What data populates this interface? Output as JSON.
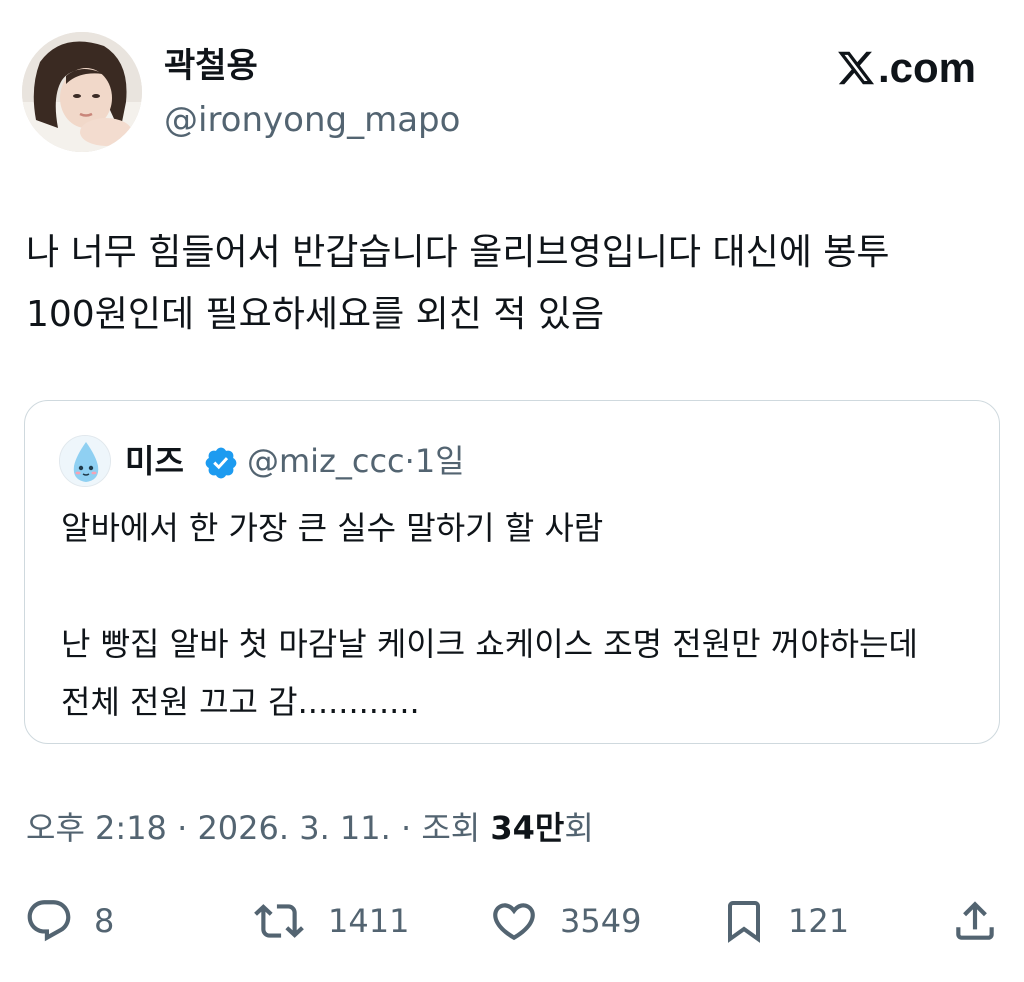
{
  "author": {
    "display_name": "곽철용",
    "handle": "@ironyong_mapo"
  },
  "brand": {
    "logo_text": ".com"
  },
  "tweet": {
    "text": "나 너무 힘들어서 반갑습니다 올리브영입니다 대신에 봉투 100원인데 필요하세요를 외친 적 있음"
  },
  "quoted_tweet": {
    "display_name": "미즈",
    "verified": true,
    "handle": "@miz_ccc",
    "separator": "·",
    "age": "1일",
    "text": "알바에서 한 가장 큰 실수 말하기 할 사람\n\n난 빵집 알바 첫 마감날 케이크 쇼케이스 조명 전원만 꺼야하는데 전체 전원 끄고 감............"
  },
  "timestamp": {
    "time": "오후 2:18",
    "dot1": " · ",
    "date": "2026. 3. 11.",
    "dot2": " · ",
    "views_label": "조회 ",
    "views_value": "34만",
    "views_suffix": "회"
  },
  "actions": {
    "reply_count": "8",
    "retweet_count": "1411",
    "like_count": "3549",
    "bookmark_count": "121"
  },
  "colors": {
    "text_primary": "#0f1419",
    "text_secondary": "#536471",
    "border": "#cfd9de",
    "verified_blue": "#1d9bf0"
  },
  "icons": {
    "reply": "reply-bubble-icon",
    "retweet": "retweet-arrows-icon",
    "like": "heart-icon",
    "bookmark": "bookmark-icon",
    "share": "share-upload-icon",
    "verified": "verified-badge-icon",
    "logo": "x-logo-icon"
  }
}
